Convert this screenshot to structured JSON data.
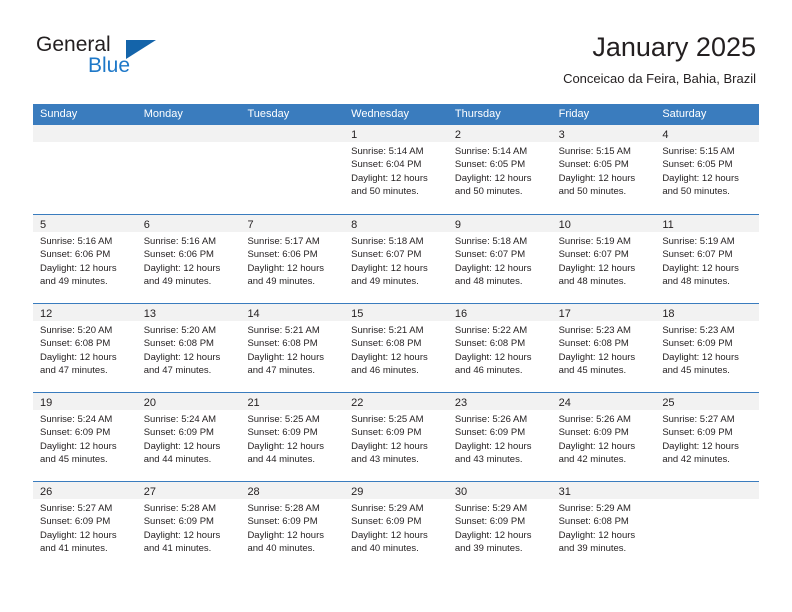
{
  "logo": {
    "word_one": "General",
    "word_two": "Blue",
    "triangle": "triangle-mark",
    "brand_color": "#1e78c8",
    "triangle_color": "#1464aa"
  },
  "header": {
    "title": "January 2025",
    "subtitle": "Conceicao da Feira, Bahia, Brazil"
  },
  "calendar": {
    "header_color": "#3a7cbe",
    "day_band_color": "#f2f2f2",
    "weekdays": [
      "Sunday",
      "Monday",
      "Tuesday",
      "Wednesday",
      "Thursday",
      "Friday",
      "Saturday"
    ],
    "weeks": [
      [
        {
          "day": "",
          "sunrise": "",
          "sunset": "",
          "daylight_line1": "",
          "daylight_line2": ""
        },
        {
          "day": "",
          "sunrise": "",
          "sunset": "",
          "daylight_line1": "",
          "daylight_line2": ""
        },
        {
          "day": "",
          "sunrise": "",
          "sunset": "",
          "daylight_line1": "",
          "daylight_line2": ""
        },
        {
          "day": "1",
          "sunrise": "Sunrise: 5:14 AM",
          "sunset": "Sunset: 6:04 PM",
          "daylight_line1": "Daylight: 12 hours",
          "daylight_line2": "and 50 minutes."
        },
        {
          "day": "2",
          "sunrise": "Sunrise: 5:14 AM",
          "sunset": "Sunset: 6:05 PM",
          "daylight_line1": "Daylight: 12 hours",
          "daylight_line2": "and 50 minutes."
        },
        {
          "day": "3",
          "sunrise": "Sunrise: 5:15 AM",
          "sunset": "Sunset: 6:05 PM",
          "daylight_line1": "Daylight: 12 hours",
          "daylight_line2": "and 50 minutes."
        },
        {
          "day": "4",
          "sunrise": "Sunrise: 5:15 AM",
          "sunset": "Sunset: 6:05 PM",
          "daylight_line1": "Daylight: 12 hours",
          "daylight_line2": "and 50 minutes."
        }
      ],
      [
        {
          "day": "5",
          "sunrise": "Sunrise: 5:16 AM",
          "sunset": "Sunset: 6:06 PM",
          "daylight_line1": "Daylight: 12 hours",
          "daylight_line2": "and 49 minutes."
        },
        {
          "day": "6",
          "sunrise": "Sunrise: 5:16 AM",
          "sunset": "Sunset: 6:06 PM",
          "daylight_line1": "Daylight: 12 hours",
          "daylight_line2": "and 49 minutes."
        },
        {
          "day": "7",
          "sunrise": "Sunrise: 5:17 AM",
          "sunset": "Sunset: 6:06 PM",
          "daylight_line1": "Daylight: 12 hours",
          "daylight_line2": "and 49 minutes."
        },
        {
          "day": "8",
          "sunrise": "Sunrise: 5:18 AM",
          "sunset": "Sunset: 6:07 PM",
          "daylight_line1": "Daylight: 12 hours",
          "daylight_line2": "and 49 minutes."
        },
        {
          "day": "9",
          "sunrise": "Sunrise: 5:18 AM",
          "sunset": "Sunset: 6:07 PM",
          "daylight_line1": "Daylight: 12 hours",
          "daylight_line2": "and 48 minutes."
        },
        {
          "day": "10",
          "sunrise": "Sunrise: 5:19 AM",
          "sunset": "Sunset: 6:07 PM",
          "daylight_line1": "Daylight: 12 hours",
          "daylight_line2": "and 48 minutes."
        },
        {
          "day": "11",
          "sunrise": "Sunrise: 5:19 AM",
          "sunset": "Sunset: 6:07 PM",
          "daylight_line1": "Daylight: 12 hours",
          "daylight_line2": "and 48 minutes."
        }
      ],
      [
        {
          "day": "12",
          "sunrise": "Sunrise: 5:20 AM",
          "sunset": "Sunset: 6:08 PM",
          "daylight_line1": "Daylight: 12 hours",
          "daylight_line2": "and 47 minutes."
        },
        {
          "day": "13",
          "sunrise": "Sunrise: 5:20 AM",
          "sunset": "Sunset: 6:08 PM",
          "daylight_line1": "Daylight: 12 hours",
          "daylight_line2": "and 47 minutes."
        },
        {
          "day": "14",
          "sunrise": "Sunrise: 5:21 AM",
          "sunset": "Sunset: 6:08 PM",
          "daylight_line1": "Daylight: 12 hours",
          "daylight_line2": "and 47 minutes."
        },
        {
          "day": "15",
          "sunrise": "Sunrise: 5:21 AM",
          "sunset": "Sunset: 6:08 PM",
          "daylight_line1": "Daylight: 12 hours",
          "daylight_line2": "and 46 minutes."
        },
        {
          "day": "16",
          "sunrise": "Sunrise: 5:22 AM",
          "sunset": "Sunset: 6:08 PM",
          "daylight_line1": "Daylight: 12 hours",
          "daylight_line2": "and 46 minutes."
        },
        {
          "day": "17",
          "sunrise": "Sunrise: 5:23 AM",
          "sunset": "Sunset: 6:08 PM",
          "daylight_line1": "Daylight: 12 hours",
          "daylight_line2": "and 45 minutes."
        },
        {
          "day": "18",
          "sunrise": "Sunrise: 5:23 AM",
          "sunset": "Sunset: 6:09 PM",
          "daylight_line1": "Daylight: 12 hours",
          "daylight_line2": "and 45 minutes."
        }
      ],
      [
        {
          "day": "19",
          "sunrise": "Sunrise: 5:24 AM",
          "sunset": "Sunset: 6:09 PM",
          "daylight_line1": "Daylight: 12 hours",
          "daylight_line2": "and 45 minutes."
        },
        {
          "day": "20",
          "sunrise": "Sunrise: 5:24 AM",
          "sunset": "Sunset: 6:09 PM",
          "daylight_line1": "Daylight: 12 hours",
          "daylight_line2": "and 44 minutes."
        },
        {
          "day": "21",
          "sunrise": "Sunrise: 5:25 AM",
          "sunset": "Sunset: 6:09 PM",
          "daylight_line1": "Daylight: 12 hours",
          "daylight_line2": "and 44 minutes."
        },
        {
          "day": "22",
          "sunrise": "Sunrise: 5:25 AM",
          "sunset": "Sunset: 6:09 PM",
          "daylight_line1": "Daylight: 12 hours",
          "daylight_line2": "and 43 minutes."
        },
        {
          "day": "23",
          "sunrise": "Sunrise: 5:26 AM",
          "sunset": "Sunset: 6:09 PM",
          "daylight_line1": "Daylight: 12 hours",
          "daylight_line2": "and 43 minutes."
        },
        {
          "day": "24",
          "sunrise": "Sunrise: 5:26 AM",
          "sunset": "Sunset: 6:09 PM",
          "daylight_line1": "Daylight: 12 hours",
          "daylight_line2": "and 42 minutes."
        },
        {
          "day": "25",
          "sunrise": "Sunrise: 5:27 AM",
          "sunset": "Sunset: 6:09 PM",
          "daylight_line1": "Daylight: 12 hours",
          "daylight_line2": "and 42 minutes."
        }
      ],
      [
        {
          "day": "26",
          "sunrise": "Sunrise: 5:27 AM",
          "sunset": "Sunset: 6:09 PM",
          "daylight_line1": "Daylight: 12 hours",
          "daylight_line2": "and 41 minutes."
        },
        {
          "day": "27",
          "sunrise": "Sunrise: 5:28 AM",
          "sunset": "Sunset: 6:09 PM",
          "daylight_line1": "Daylight: 12 hours",
          "daylight_line2": "and 41 minutes."
        },
        {
          "day": "28",
          "sunrise": "Sunrise: 5:28 AM",
          "sunset": "Sunset: 6:09 PM",
          "daylight_line1": "Daylight: 12 hours",
          "daylight_line2": "and 40 minutes."
        },
        {
          "day": "29",
          "sunrise": "Sunrise: 5:29 AM",
          "sunset": "Sunset: 6:09 PM",
          "daylight_line1": "Daylight: 12 hours",
          "daylight_line2": "and 40 minutes."
        },
        {
          "day": "30",
          "sunrise": "Sunrise: 5:29 AM",
          "sunset": "Sunset: 6:09 PM",
          "daylight_line1": "Daylight: 12 hours",
          "daylight_line2": "and 39 minutes."
        },
        {
          "day": "31",
          "sunrise": "Sunrise: 5:29 AM",
          "sunset": "Sunset: 6:08 PM",
          "daylight_line1": "Daylight: 12 hours",
          "daylight_line2": "and 39 minutes."
        },
        {
          "day": "",
          "sunrise": "",
          "sunset": "",
          "daylight_line1": "",
          "daylight_line2": ""
        }
      ]
    ]
  }
}
